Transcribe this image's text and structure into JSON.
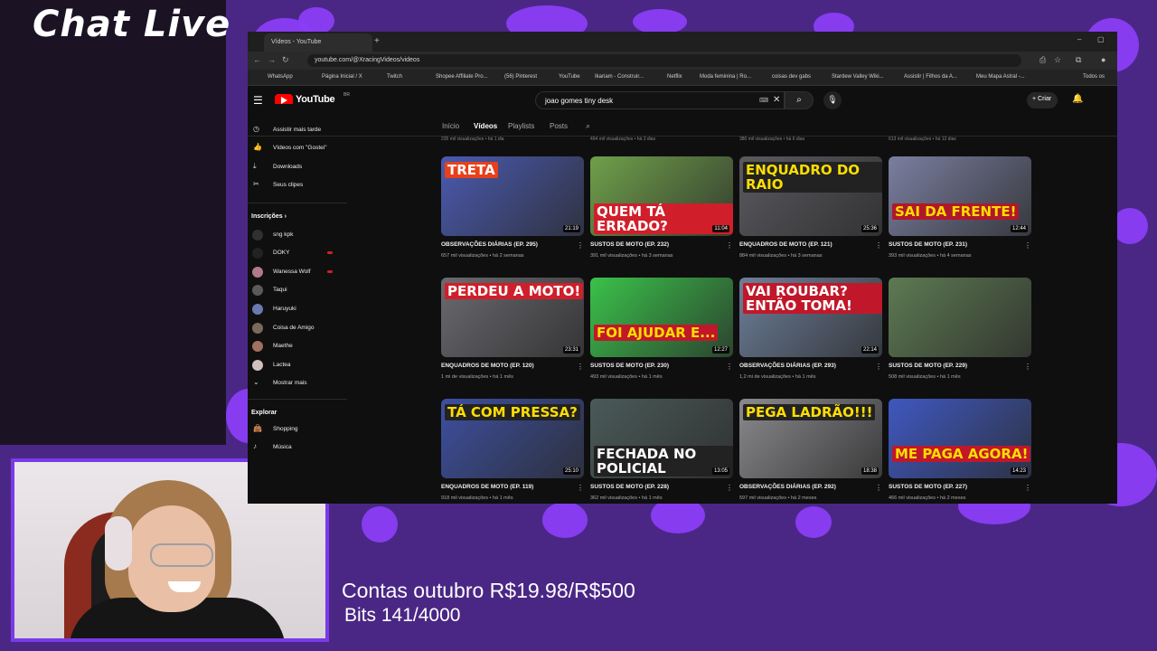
{
  "overlay": {
    "chat_title": "Chat Live",
    "goal": "Contas outubro R$19.98/R$500",
    "bits": "Bits 141/4000"
  },
  "browser": {
    "tab_title": "Vídeos - YouTube",
    "url": "youtube.com/@XracingVideos/videos",
    "bookmarks": [
      "WhatsApp",
      "Página Inicial / X",
      "Twitch",
      "Shopee Affiliate Pro...",
      "(56) Pinterest",
      "YouTube",
      "Ikariam - Construir...",
      "Netflix",
      "Moda feminina | Ro...",
      "coisas dev gabs",
      "Stardew Valley Wiki...",
      "Assistir | Filhos da A...",
      "Meu Mapa Astral -...",
      "Todos os"
    ]
  },
  "youtube": {
    "brand": "YouTube",
    "region": "BR",
    "search_value": "joao gomes tiny desk",
    "create_label": "Criar",
    "tabs": [
      "Início",
      "Vídeos",
      "Playlists",
      "Posts"
    ],
    "active_tab": "Vídeos",
    "sidebar": {
      "items": [
        "Assistir mais tarde",
        "Vídeos com \"Gostei\"",
        "Downloads",
        "Seus clipes"
      ],
      "subs_header": "Inscrições",
      "subscriptions": [
        "sng kpk",
        "DOKY",
        "Wanessa Wolf",
        "Taqui",
        "Haruyuki",
        "Coisa de Amigo",
        "Maethe",
        "Lactea",
        "Mostrar mais"
      ],
      "explore_header": "Explorar",
      "explore": [
        "Shopping",
        "Música"
      ]
    },
    "previous_row_meta": [
      "235 mil visualizações • há 1 dia",
      "494 mil visualizações • há 3 dias",
      "380 mil visualizações • há 6 dias",
      "613 mil visualizações • há 12 dias"
    ],
    "videos": [
      {
        "title": "OBSERVAÇÕES DIÁRIAS (EP. 295)",
        "meta": "657 mil visualizações • há 2 semanas",
        "duration": "21:19",
        "caption": "TRETA",
        "caption_color": "#ffffff",
        "caption_bg": "#e8401a",
        "bg": "#4a5ab0"
      },
      {
        "title": "SUSTOS DE MOTO (EP. 232)",
        "meta": "391 mil visualizações • há 3 semanas",
        "duration": "11:04",
        "caption": "QUEM TÁ ERRADO?",
        "caption_color": "#ffffff",
        "caption_bg": "#d01f2a",
        "bg": "#6fa04a"
      },
      {
        "title": "ENQUADROS DE MOTO (EP. 121)",
        "meta": "884 mil visualizações • há 3 semanas",
        "duration": "25:36",
        "caption": "ENQUADRO DO RAIO",
        "caption_color": "#ffde00",
        "caption_bg": "#222222",
        "bg": "#5a5a60"
      },
      {
        "title": "SUSTOS DE MOTO (EP. 231)",
        "meta": "393 mil visualizações • há 4 semanas",
        "duration": "12:44",
        "caption": "SAI DA FRENTE!",
        "caption_color": "#ffde00",
        "caption_bg": "#b0182a",
        "bg": "#7a7fa0"
      },
      {
        "title": "ENQUADROS DE MOTO (EP. 120)",
        "meta": "1 mi de visualizações • há 1 mês",
        "duration": "23:31",
        "caption": "PERDEU A MOTO!",
        "caption_color": "#ffffff",
        "caption_bg": "#d01f2a",
        "bg": "#6a6a70"
      },
      {
        "title": "SUSTOS DE MOTO (EP. 230)",
        "meta": "493 mil visualizações • há 1 mês",
        "duration": "12:27",
        "caption": "FOI AJUDAR E...",
        "caption_color": "#ffde00",
        "caption_bg": "#c0182a",
        "bg": "#3ac24a"
      },
      {
        "title": "OBSERVAÇÕES DIÁRIAS (EP. 293)",
        "meta": "1,2 mi de visualizações • há 1 mês",
        "duration": "22:14",
        "caption": "VAI ROUBAR? ENTÃO TOMA!",
        "caption_color": "#ffffff",
        "caption_bg": "#c0182a",
        "bg": "#6d7f9a"
      },
      {
        "title": "SUSTOS DE MOTO (EP. 229)",
        "meta": "508 mil visualizações • há 1 mês",
        "duration": "",
        "caption": "",
        "caption_color": "#ffffff",
        "caption_bg": "transparent",
        "bg": "#5d7a52"
      },
      {
        "title": "ENQUADROS DE MOTO (EP. 119)",
        "meta": "918 mil visualizações • há 1 mês",
        "duration": "25:10",
        "caption": "TÁ COM PRESSA?",
        "caption_color": "#ffde00",
        "caption_bg": "#222222",
        "bg": "#3d4fa0"
      },
      {
        "title": "SUSTOS DE MOTO (EP. 228)",
        "meta": "362 mil visualizações • há 1 mês",
        "duration": "13:05",
        "caption": "FECHADA NO POLICIAL",
        "caption_color": "#ffffff",
        "caption_bg": "#222222",
        "bg": "#4a5a58"
      },
      {
        "title": "OBSERVAÇÕES DIÁRIAS (EP. 292)",
        "meta": "597 mil visualizações • há 2 meses",
        "duration": "18:38",
        "caption": "PEGA LADRÃO!!!",
        "caption_color": "#ffde00",
        "caption_bg": "#222222",
        "bg": "#8a8a8e"
      },
      {
        "title": "SUSTOS DE MOTO (EP. 227)",
        "meta": "466 mil visualizações • há 2 meses",
        "duration": "14:23",
        "caption": "ME PAGA AGORA!",
        "caption_color": "#ffde00",
        "caption_bg": "#c0182a",
        "bg": "#3f58c0"
      }
    ]
  },
  "colors": {
    "background_purple": "#4a2785",
    "splatter_purple": "#8a3df5",
    "youtube_red": "#ff0000"
  }
}
